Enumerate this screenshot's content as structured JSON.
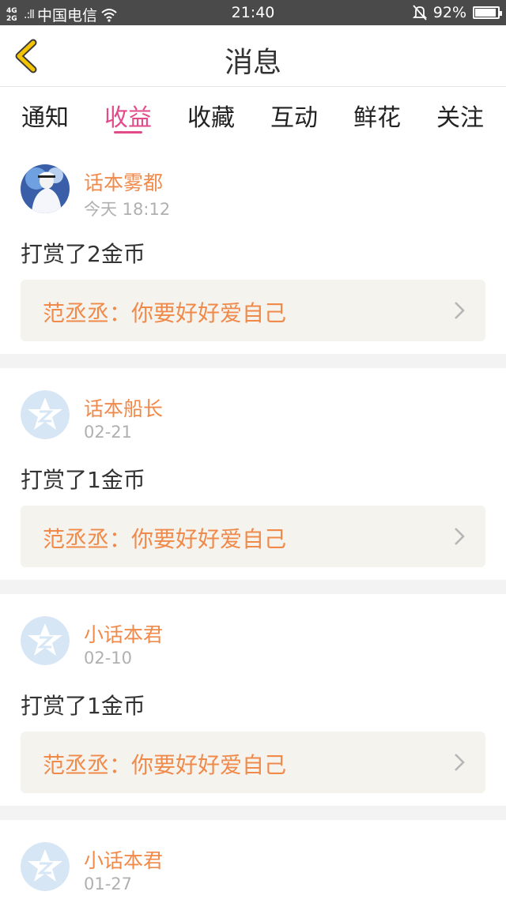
{
  "status_bar": {
    "network": "4G\n2G",
    "signal": ".:ll",
    "carrier": "中国电信",
    "time": "21:40",
    "battery": "92%",
    "battery_level": 0.92
  },
  "header": {
    "title": "消息"
  },
  "tabs": [
    {
      "label": "通知"
    },
    {
      "label": "收益"
    },
    {
      "label": "收藏"
    },
    {
      "label": "互动"
    },
    {
      "label": "鲜花"
    },
    {
      "label": "关注"
    }
  ],
  "active_tab": "收益",
  "messages": [
    {
      "user": "话本雾都",
      "date": "今天 18:12",
      "action": "打赏了2金币",
      "quote": "范丞丞：你要好好爱自己",
      "avatar": "photo-avatar"
    },
    {
      "user": "话本船长",
      "date": "02-21",
      "action": "打赏了1金币",
      "quote": "范丞丞：你要好好爱自己",
      "avatar": "default-avatar"
    },
    {
      "user": "小话本君",
      "date": "02-10",
      "action": "打赏了1金币",
      "quote": "范丞丞：你要好好爱自己",
      "avatar": "default-avatar"
    },
    {
      "user": "小话本君",
      "date": "01-27",
      "action": "",
      "quote": "",
      "avatar": "default-avatar"
    }
  ],
  "colors": {
    "accent": "#e24a8a",
    "username": "#f08a4b",
    "status_bar": "#4a4a4a",
    "back_icon": "#f5c400"
  }
}
